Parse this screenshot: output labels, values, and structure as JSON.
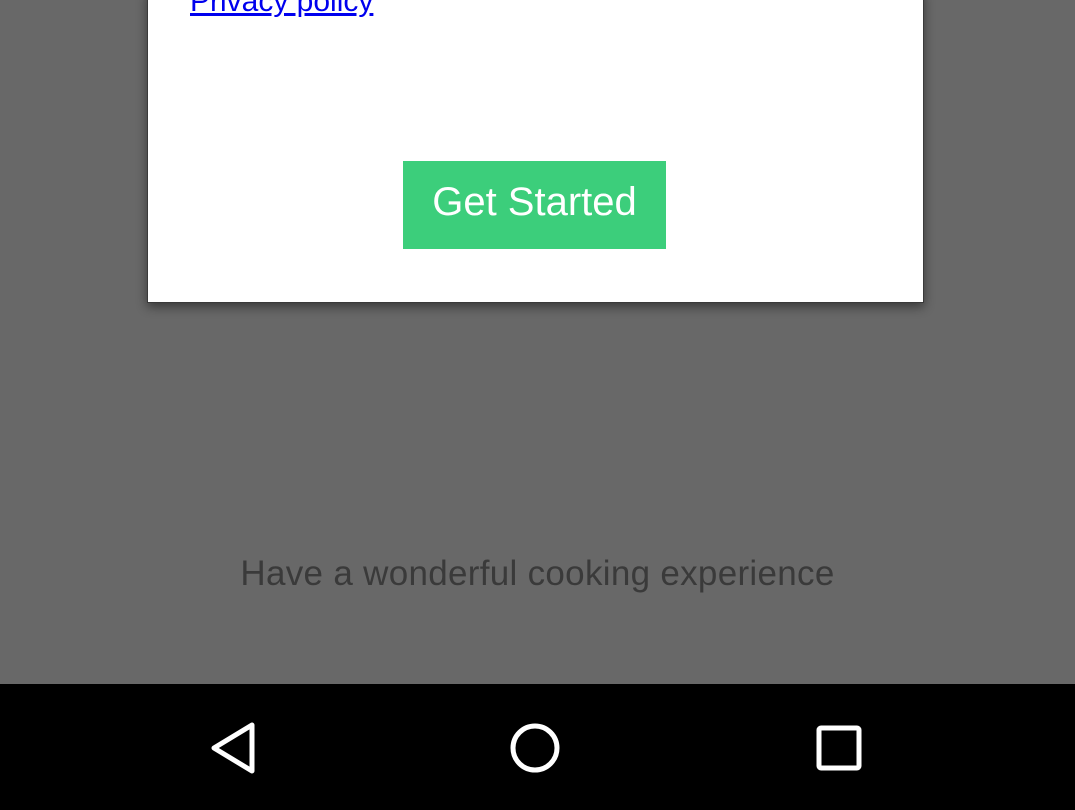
{
  "dialog": {
    "privacy_link": "Privacy policy",
    "get_started_label": "Get Started"
  },
  "background": {
    "tagline": "Have a wonderful cooking experience"
  },
  "nav_bar": {
    "back_icon": "back-triangle-icon",
    "home_icon": "home-circle-icon",
    "recents_icon": "recents-square-icon"
  },
  "colors": {
    "scrim": "#686868",
    "button_green": "#3cce7b",
    "link_blue": "#0000ee",
    "nav_bar": "#000000"
  }
}
